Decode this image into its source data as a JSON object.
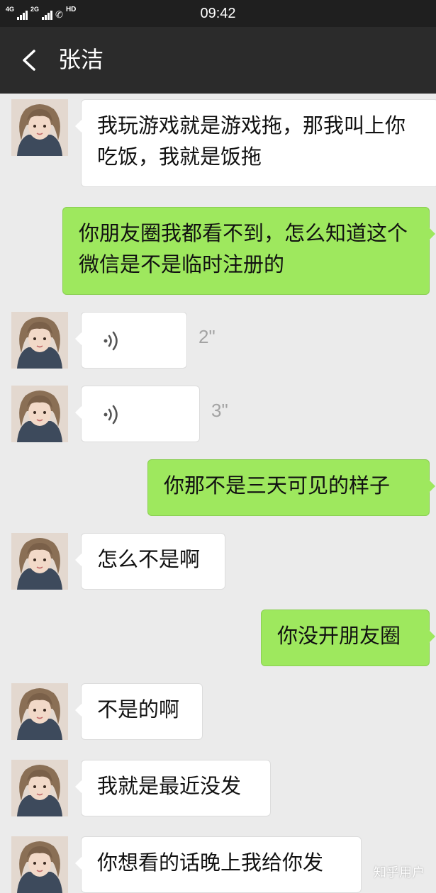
{
  "status_bar": {
    "network_1": "4G",
    "network_2": "2G",
    "hd": "HD",
    "time": "09:42"
  },
  "nav": {
    "back_icon": "chevron-left-icon",
    "title": "张洁"
  },
  "messages": [
    {
      "side": "in",
      "type": "text",
      "text": "我玩游戏就是游戏拖，那我叫上你吃饭，我就是饭拖"
    },
    {
      "side": "out",
      "type": "text",
      "text": "你朋友圈我都看不到，怎么知道这个微信是不是临时注册的"
    },
    {
      "side": "in",
      "type": "voice",
      "duration": "2\""
    },
    {
      "side": "in",
      "type": "voice",
      "duration": "3\""
    },
    {
      "side": "out",
      "type": "text",
      "text": "你那不是三天可见的样子"
    },
    {
      "side": "in",
      "type": "text",
      "text": "怎么不是啊"
    },
    {
      "side": "out",
      "type": "text",
      "text": "你没开朋友圈"
    },
    {
      "side": "in",
      "type": "text",
      "text": "不是的啊"
    },
    {
      "side": "in",
      "type": "text",
      "text": "我就是最近没发"
    },
    {
      "side": "in",
      "type": "text",
      "text": "你想看的话晚上我给你发"
    }
  ],
  "watermark": "知乎用户",
  "colors": {
    "chat_background": "#ebebeb",
    "nav_background": "#2b2b2b",
    "outgoing_bubble": "#9ee85e",
    "incoming_bubble": "#ffffff"
  }
}
